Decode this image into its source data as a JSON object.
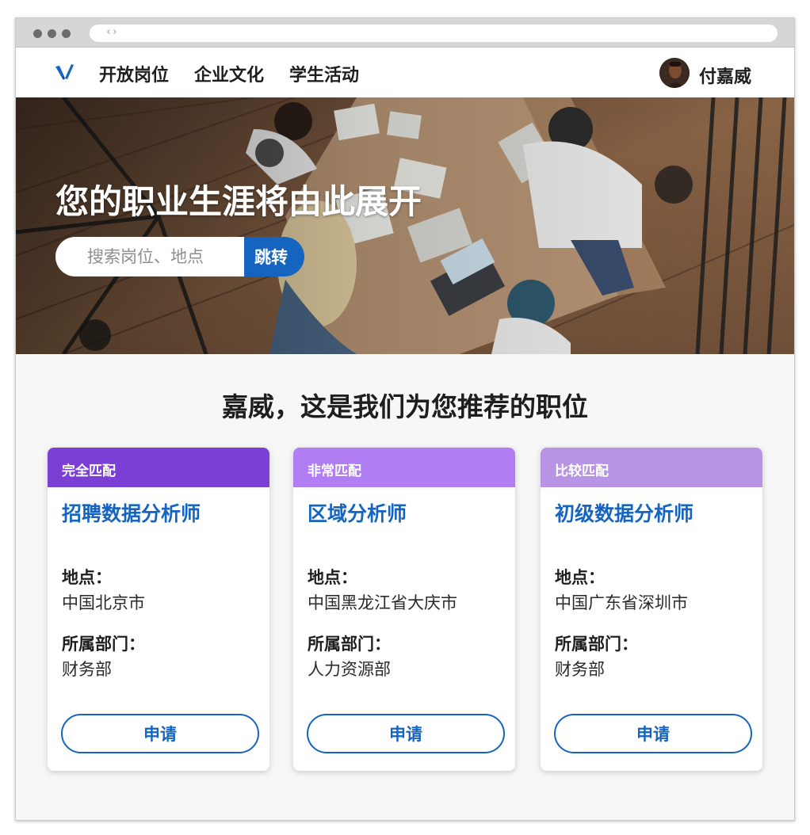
{
  "nav": {
    "links": [
      "开放岗位",
      "企业文化",
      "学生活动"
    ],
    "user_name": "付嘉威"
  },
  "hero": {
    "title": "您的职业生涯将由此展开",
    "search_placeholder": "搜索岗位、地点",
    "search_button": "跳转"
  },
  "section_title": "嘉威，这是我们为您推荐的职位",
  "jobs": [
    {
      "match": "完全匹配",
      "match_color": "#7c3fd6",
      "title": "招聘数据分析师",
      "location_label": "地点：",
      "location": "中国北京市",
      "department_label": "所属部门：",
      "department": "财务部",
      "apply": "申请"
    },
    {
      "match": "非常匹配",
      "match_color": "#b07ef2",
      "title": "区域分析师",
      "location_label": "地点：",
      "location": "中国黑龙江省大庆市",
      "department_label": "所属部门：",
      "department": "人力资源部",
      "apply": "申请"
    },
    {
      "match": "比较匹配",
      "match_color": "#b895e4",
      "title": "初级数据分析师",
      "location_label": "地点：",
      "location": "中国广东省深圳市",
      "department_label": "所属部门：",
      "department": "财务部",
      "apply": "申请"
    }
  ],
  "colors": {
    "accent": "#1565c0",
    "logo": "#1565c0"
  }
}
